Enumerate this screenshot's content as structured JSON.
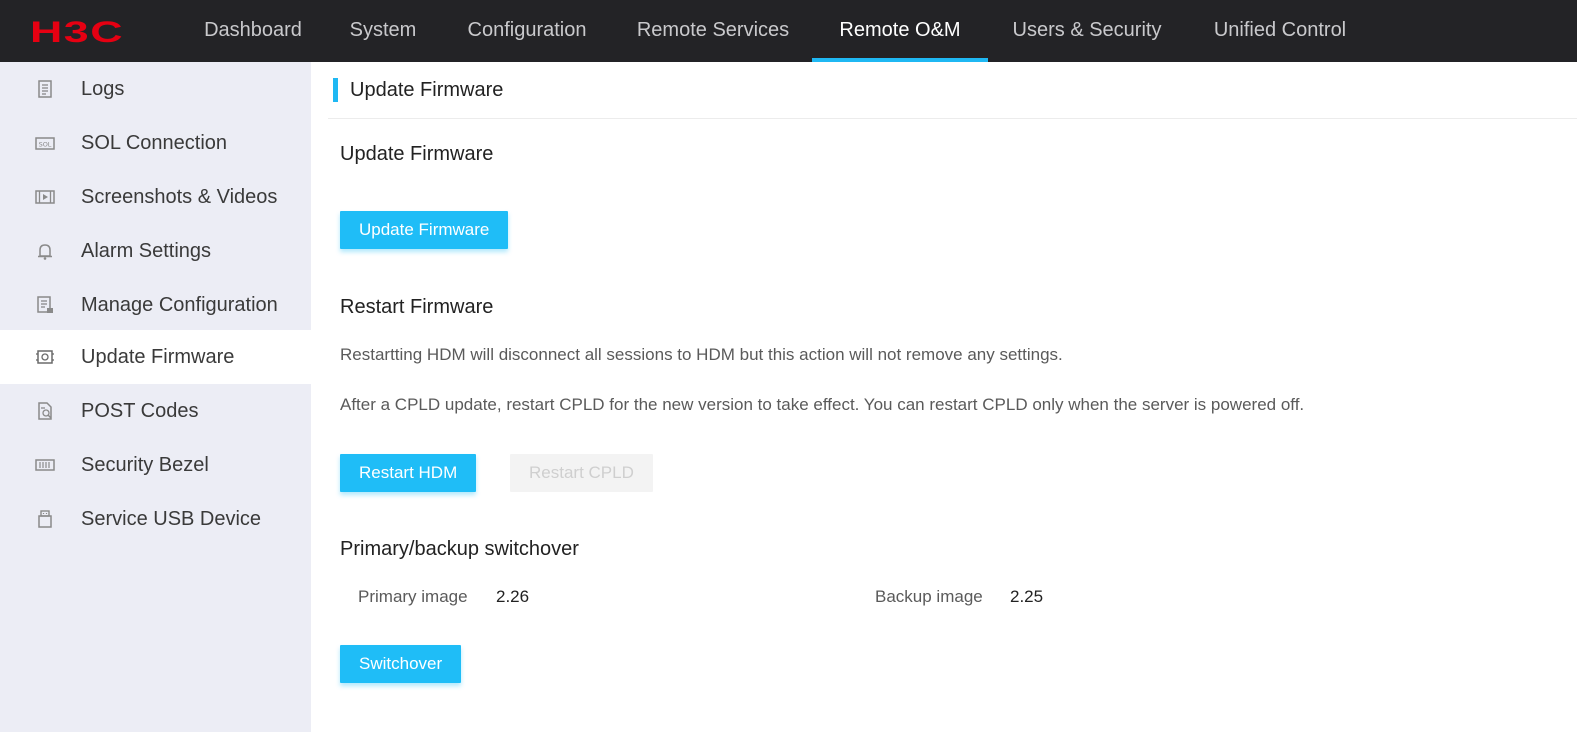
{
  "brand": {
    "logo_text": "H3C",
    "logo_color": "#e60012",
    "accent": "#1fb8f3",
    "button_color": "#1fbdf7"
  },
  "topnav": {
    "tabs": [
      {
        "label": "Dashboard"
      },
      {
        "label": "System"
      },
      {
        "label": "Configuration"
      },
      {
        "label": "Remote Services"
      },
      {
        "label": "Remote O&M",
        "active": true
      },
      {
        "label": "Users & Security"
      },
      {
        "label": "Unified Control"
      }
    ]
  },
  "sidebar": {
    "items": [
      {
        "label": "Logs",
        "icon": "logs-icon"
      },
      {
        "label": "SOL Connection",
        "icon": "sol-icon"
      },
      {
        "label": "Screenshots & Videos",
        "icon": "video-icon"
      },
      {
        "label": "Alarm Settings",
        "icon": "alarm-bell-icon"
      },
      {
        "label": "Manage Configuration",
        "icon": "config-document-icon"
      },
      {
        "label": "Update Firmware",
        "icon": "firmware-chip-icon",
        "active": true
      },
      {
        "label": "POST Codes",
        "icon": "post-codes-icon"
      },
      {
        "label": "Security Bezel",
        "icon": "bezel-icon"
      },
      {
        "label": "Service USB Device",
        "icon": "usb-icon"
      }
    ]
  },
  "main": {
    "page_title": "Update Firmware",
    "update_section": {
      "title": "Update Firmware",
      "button": "Update Firmware"
    },
    "restart_section": {
      "title": "Restart Firmware",
      "desc1": "Restartting HDM will disconnect all sessions to HDM but this action will not remove any settings.",
      "desc2": "After a CPLD update, restart CPLD for the new version to take effect. You can restart CPLD only when the server is powered off.",
      "restart_hdm": "Restart HDM",
      "restart_cpld": "Restart CPLD"
    },
    "switchover_section": {
      "title": "Primary/backup switchover",
      "primary_label": "Primary image",
      "primary_value": "2.26",
      "backup_label": "Backup image",
      "backup_value": "2.25",
      "button": "Switchover"
    }
  }
}
